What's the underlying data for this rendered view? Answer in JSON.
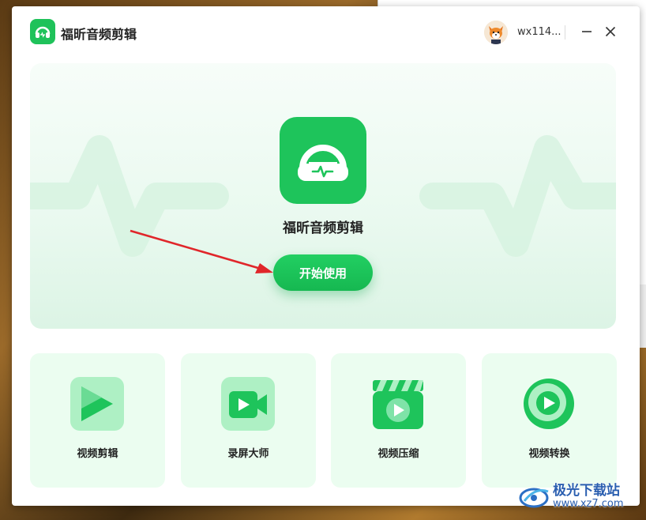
{
  "titlebar": {
    "app_title": "福昕音频剪辑",
    "username": "wx114...",
    "minimize_icon": "minus-icon",
    "close_icon": "close-icon"
  },
  "hero": {
    "app_name": "福昕音频剪辑",
    "start_button_label": "开始使用"
  },
  "tools": [
    {
      "label": "视频剪辑",
      "icon": "video-edit-icon"
    },
    {
      "label": "录屏大师",
      "icon": "screen-record-icon"
    },
    {
      "label": "视频压缩",
      "icon": "video-compress-icon"
    },
    {
      "label": "视频转换",
      "icon": "video-convert-icon"
    }
  ],
  "watermark": {
    "line1": "极光下载站",
    "line2": "www.xz7.com"
  },
  "colors": {
    "brand_green": "#1ec45b",
    "card_bg": "#ebfdf0",
    "arrow_red": "#e0262a"
  }
}
